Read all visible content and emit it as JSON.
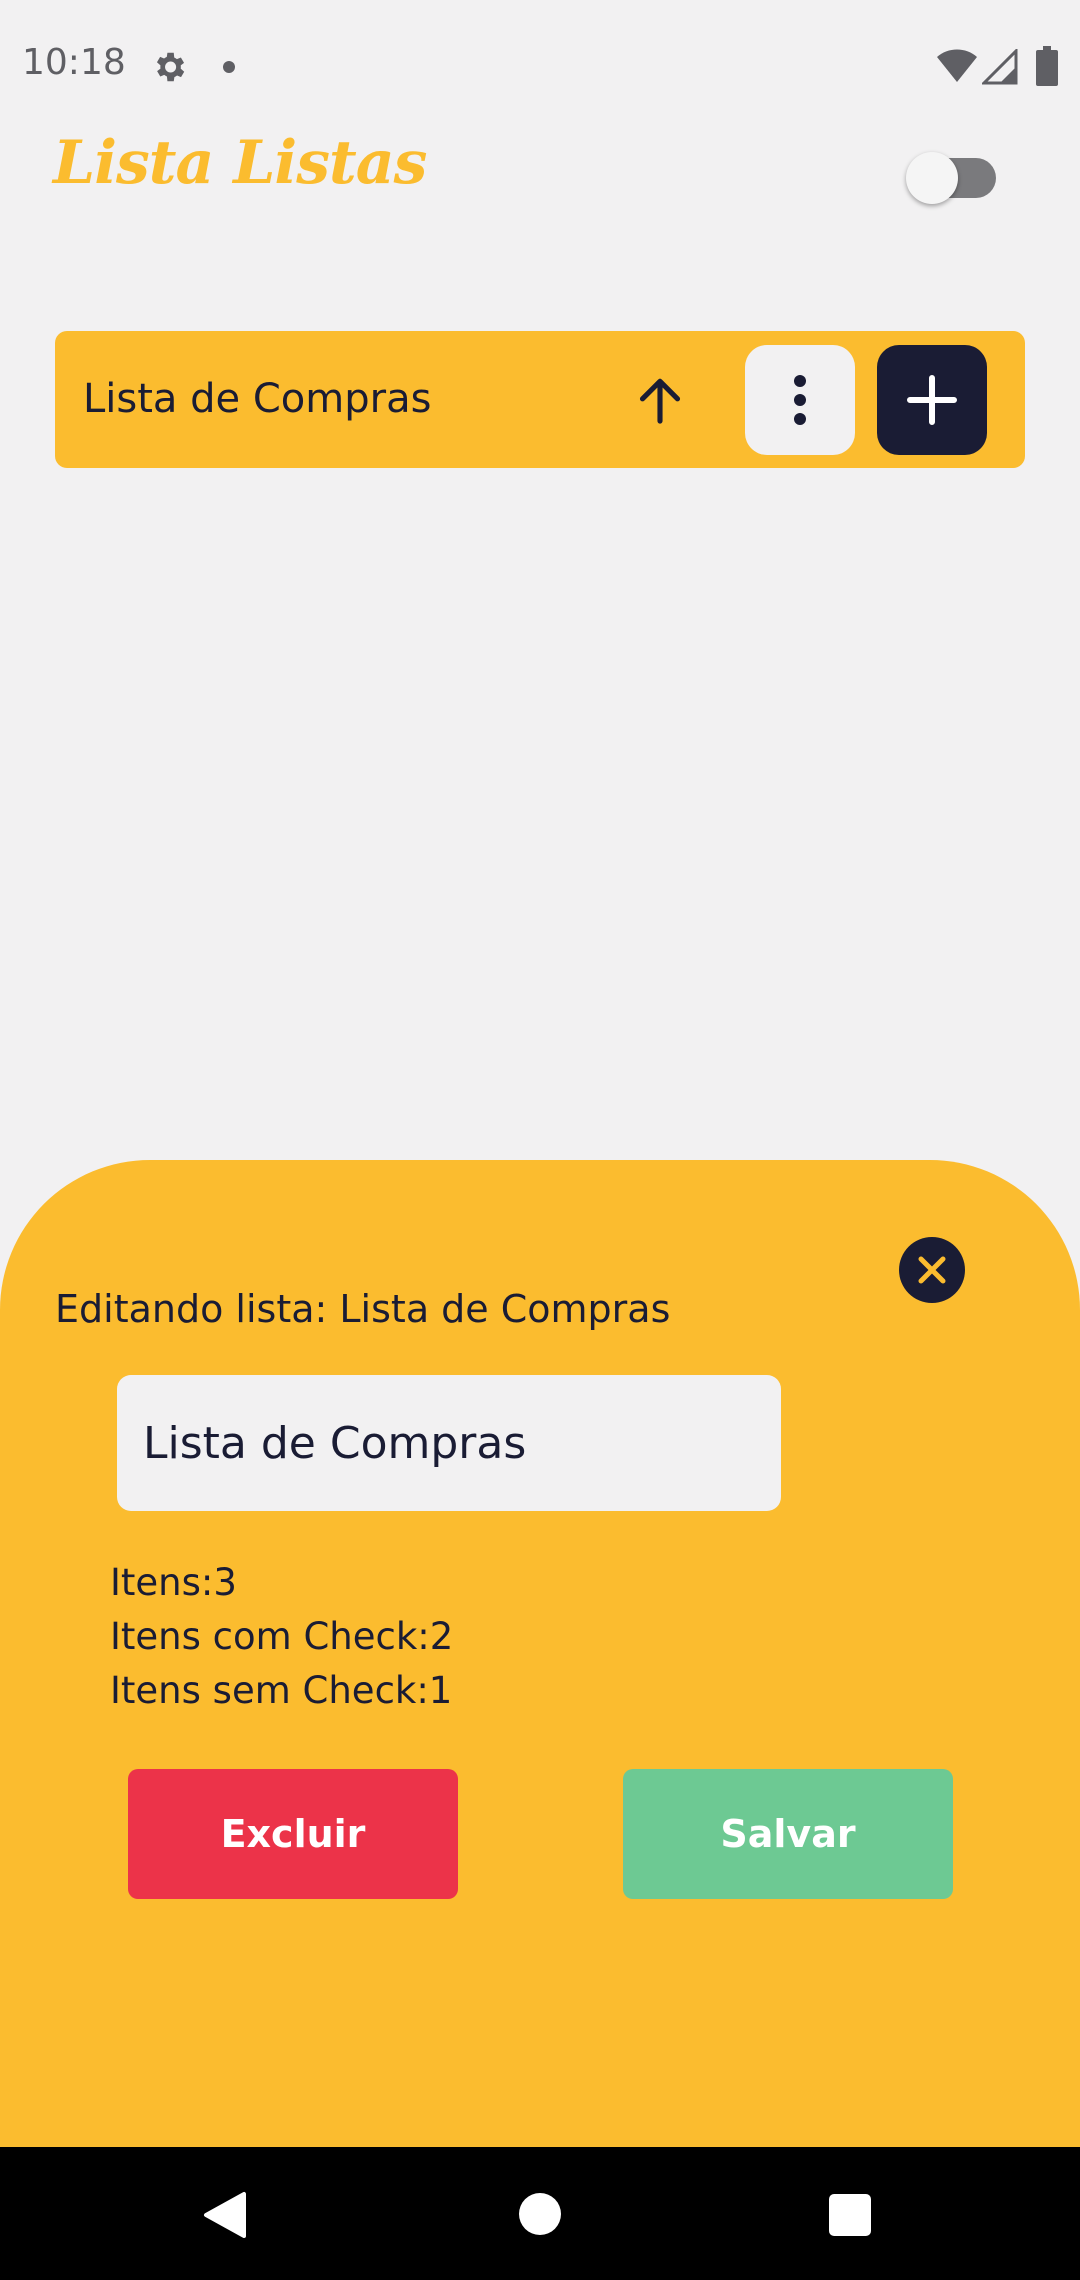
{
  "status_bar": {
    "time": "10:18",
    "icons": [
      "gear-icon",
      "dot-icon",
      "wifi-icon",
      "signal-icon",
      "battery-icon"
    ]
  },
  "header": {
    "title": "Lista Listas",
    "toggle_state": "off"
  },
  "lists": [
    {
      "name": "Lista de Compras"
    }
  ],
  "edit_sheet": {
    "heading": "Editando lista: Lista de Compras",
    "input_value": "Lista de Compras",
    "stats": {
      "total": "Itens:3",
      "checked": "Itens com Check:2",
      "unchecked": "Itens sem Check:1"
    },
    "delete_label": "Excluir",
    "save_label": "Salvar"
  },
  "colors": {
    "accent": "#fbbc2f",
    "dark": "#1a1c34",
    "background": "#f2f1f2",
    "danger": "#ec3349",
    "success": "#6dc993"
  }
}
